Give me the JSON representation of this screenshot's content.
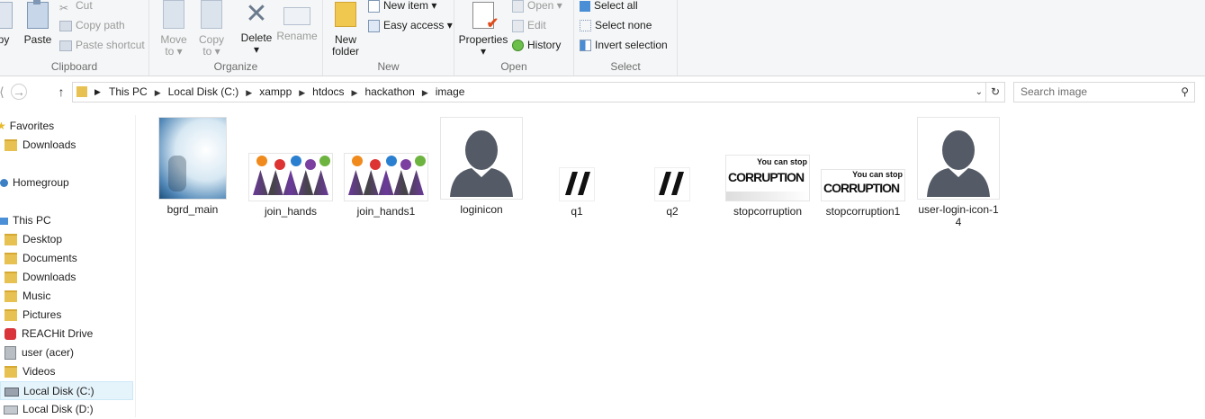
{
  "ribbon": {
    "clipboard": {
      "label": "Clipboard",
      "copy": "py",
      "paste": "Paste",
      "cut": "Cut",
      "copy_path": "Copy path",
      "paste_shortcut": "Paste shortcut"
    },
    "organize": {
      "label": "Organize",
      "move_to": "Move",
      "move_to2": "to",
      "copy_to": "Copy",
      "copy_to2": "to",
      "delete": "Delete",
      "rename": "Rename"
    },
    "new": {
      "label": "New",
      "new_folder": "New",
      "new_folder2": "folder",
      "new_item": "New item",
      "easy_access": "Easy access"
    },
    "open": {
      "label": "Open",
      "properties": "Properties",
      "open": "Open",
      "edit": "Edit",
      "history": "History"
    },
    "select": {
      "label": "Select",
      "select_all": "Select all",
      "select_none": "Select none",
      "invert": "Invert selection"
    }
  },
  "address": {
    "crumbs": [
      "This PC",
      "Local Disk (C:)",
      "xampp",
      "htdocs",
      "hackathon",
      "image"
    ],
    "search_placeholder": "Search image"
  },
  "nav": {
    "favorites": "Favorites",
    "downloads_fav": "Downloads",
    "homegroup": "Homegroup",
    "this_pc": "This PC",
    "desktop": "Desktop",
    "documents": "Documents",
    "downloads": "Downloads",
    "music": "Music",
    "pictures": "Pictures",
    "reachit": "REACHit Drive",
    "user": "user (acer)",
    "videos": "Videos",
    "local_c": "Local Disk (C:)",
    "local_d": "Local Disk (D:)"
  },
  "files": [
    {
      "name": "bgrd_main"
    },
    {
      "name": "join_hands"
    },
    {
      "name": "join_hands1"
    },
    {
      "name": "loginicon"
    },
    {
      "name": "q1"
    },
    {
      "name": "q2"
    },
    {
      "name": "stopcorruption",
      "text1": "You can stop",
      "text2": "CORRUPTION"
    },
    {
      "name": "stopcorruption1",
      "text1": "You can stop",
      "text2": "CORRUPTION"
    },
    {
      "name": "user-login-icon-14"
    }
  ],
  "colors": {
    "accent": "#e5f3fb",
    "folder": "#e8c153",
    "avatar": "#545b66"
  }
}
